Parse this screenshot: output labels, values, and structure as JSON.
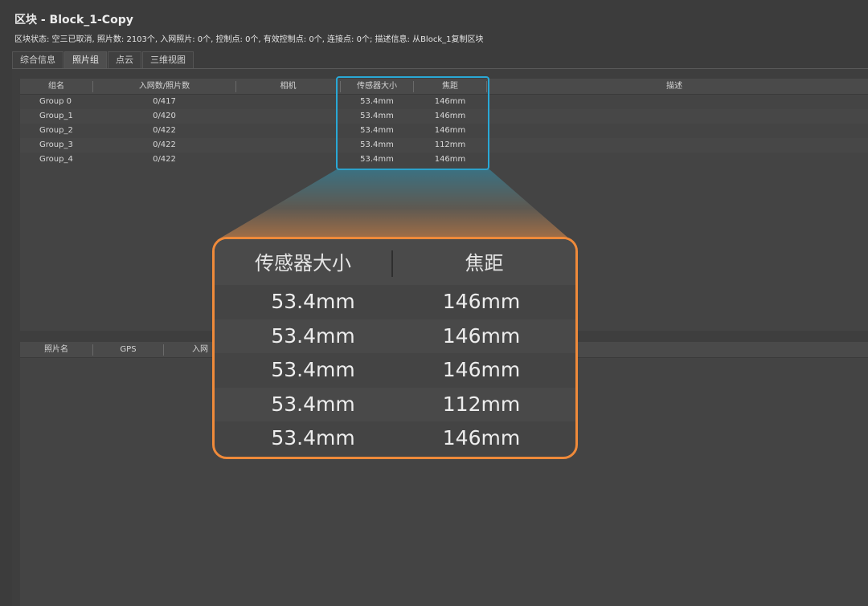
{
  "window": {
    "title": "区块 - Block_1-Copy",
    "status_line": "区块状态: 空三已取消, 照片数: 2103个, 入网照片: 0个, 控制点: 0个, 有效控制点: 0个, 连接点: 0个; 描述信息: 从Block_1复制区块"
  },
  "tabs": [
    "综合信息",
    "照片组",
    "点云",
    "三维视图"
  ],
  "active_tab": "照片组",
  "groups_table": {
    "columns": [
      "组名",
      "入网数/照片数",
      "相机",
      "传感器大小",
      "焦距",
      "描述"
    ],
    "rows": [
      {
        "name": "Group 0",
        "count": "0/417",
        "sensor": "53.4mm",
        "focal": "146mm"
      },
      {
        "name": "Group_1",
        "count": "0/420",
        "sensor": "53.4mm",
        "focal": "146mm"
      },
      {
        "name": "Group_2",
        "count": "0/422",
        "sensor": "53.4mm",
        "focal": "146mm"
      },
      {
        "name": "Group_3",
        "count": "0/422",
        "sensor": "53.4mm",
        "focal": "112mm"
      },
      {
        "name": "Group_4",
        "count": "0/422",
        "sensor": "53.4mm",
        "focal": "146mm"
      }
    ]
  },
  "photos_table": {
    "columns": [
      "照片名",
      "GPS",
      "入网"
    ]
  },
  "zoom_callout": {
    "columns": [
      "传感器大小",
      "焦距"
    ],
    "rows": [
      {
        "sensor": "53.4mm",
        "focal": "146mm"
      },
      {
        "sensor": "53.4mm",
        "focal": "146mm"
      },
      {
        "sensor": "53.4mm",
        "focal": "146mm"
      },
      {
        "sensor": "53.4mm",
        "focal": "112mm"
      },
      {
        "sensor": "53.4mm",
        "focal": "146mm"
      }
    ]
  },
  "colors": {
    "background": "#3c3c3c",
    "highlight_small": "#29a8d6",
    "highlight_zoom": "#ef8a3a"
  }
}
